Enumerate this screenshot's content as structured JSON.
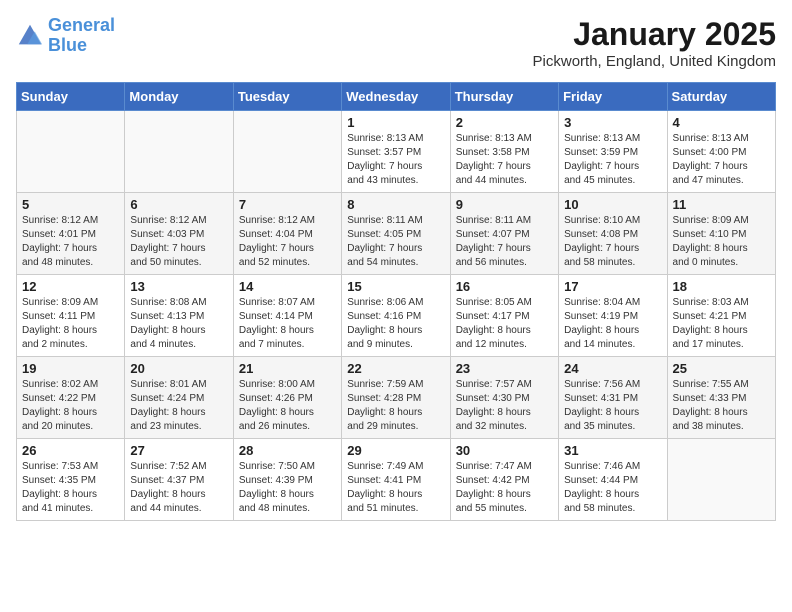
{
  "logo": {
    "line1": "General",
    "line2": "Blue"
  },
  "title": "January 2025",
  "location": "Pickworth, England, United Kingdom",
  "weekdays": [
    "Sunday",
    "Monday",
    "Tuesday",
    "Wednesday",
    "Thursday",
    "Friday",
    "Saturday"
  ],
  "weeks": [
    [
      {
        "day": "",
        "info": ""
      },
      {
        "day": "",
        "info": ""
      },
      {
        "day": "",
        "info": ""
      },
      {
        "day": "1",
        "info": "Sunrise: 8:13 AM\nSunset: 3:57 PM\nDaylight: 7 hours\nand 43 minutes."
      },
      {
        "day": "2",
        "info": "Sunrise: 8:13 AM\nSunset: 3:58 PM\nDaylight: 7 hours\nand 44 minutes."
      },
      {
        "day": "3",
        "info": "Sunrise: 8:13 AM\nSunset: 3:59 PM\nDaylight: 7 hours\nand 45 minutes."
      },
      {
        "day": "4",
        "info": "Sunrise: 8:13 AM\nSunset: 4:00 PM\nDaylight: 7 hours\nand 47 minutes."
      }
    ],
    [
      {
        "day": "5",
        "info": "Sunrise: 8:12 AM\nSunset: 4:01 PM\nDaylight: 7 hours\nand 48 minutes."
      },
      {
        "day": "6",
        "info": "Sunrise: 8:12 AM\nSunset: 4:03 PM\nDaylight: 7 hours\nand 50 minutes."
      },
      {
        "day": "7",
        "info": "Sunrise: 8:12 AM\nSunset: 4:04 PM\nDaylight: 7 hours\nand 52 minutes."
      },
      {
        "day": "8",
        "info": "Sunrise: 8:11 AM\nSunset: 4:05 PM\nDaylight: 7 hours\nand 54 minutes."
      },
      {
        "day": "9",
        "info": "Sunrise: 8:11 AM\nSunset: 4:07 PM\nDaylight: 7 hours\nand 56 minutes."
      },
      {
        "day": "10",
        "info": "Sunrise: 8:10 AM\nSunset: 4:08 PM\nDaylight: 7 hours\nand 58 minutes."
      },
      {
        "day": "11",
        "info": "Sunrise: 8:09 AM\nSunset: 4:10 PM\nDaylight: 8 hours\nand 0 minutes."
      }
    ],
    [
      {
        "day": "12",
        "info": "Sunrise: 8:09 AM\nSunset: 4:11 PM\nDaylight: 8 hours\nand 2 minutes."
      },
      {
        "day": "13",
        "info": "Sunrise: 8:08 AM\nSunset: 4:13 PM\nDaylight: 8 hours\nand 4 minutes."
      },
      {
        "day": "14",
        "info": "Sunrise: 8:07 AM\nSunset: 4:14 PM\nDaylight: 8 hours\nand 7 minutes."
      },
      {
        "day": "15",
        "info": "Sunrise: 8:06 AM\nSunset: 4:16 PM\nDaylight: 8 hours\nand 9 minutes."
      },
      {
        "day": "16",
        "info": "Sunrise: 8:05 AM\nSunset: 4:17 PM\nDaylight: 8 hours\nand 12 minutes."
      },
      {
        "day": "17",
        "info": "Sunrise: 8:04 AM\nSunset: 4:19 PM\nDaylight: 8 hours\nand 14 minutes."
      },
      {
        "day": "18",
        "info": "Sunrise: 8:03 AM\nSunset: 4:21 PM\nDaylight: 8 hours\nand 17 minutes."
      }
    ],
    [
      {
        "day": "19",
        "info": "Sunrise: 8:02 AM\nSunset: 4:22 PM\nDaylight: 8 hours\nand 20 minutes."
      },
      {
        "day": "20",
        "info": "Sunrise: 8:01 AM\nSunset: 4:24 PM\nDaylight: 8 hours\nand 23 minutes."
      },
      {
        "day": "21",
        "info": "Sunrise: 8:00 AM\nSunset: 4:26 PM\nDaylight: 8 hours\nand 26 minutes."
      },
      {
        "day": "22",
        "info": "Sunrise: 7:59 AM\nSunset: 4:28 PM\nDaylight: 8 hours\nand 29 minutes."
      },
      {
        "day": "23",
        "info": "Sunrise: 7:57 AM\nSunset: 4:30 PM\nDaylight: 8 hours\nand 32 minutes."
      },
      {
        "day": "24",
        "info": "Sunrise: 7:56 AM\nSunset: 4:31 PM\nDaylight: 8 hours\nand 35 minutes."
      },
      {
        "day": "25",
        "info": "Sunrise: 7:55 AM\nSunset: 4:33 PM\nDaylight: 8 hours\nand 38 minutes."
      }
    ],
    [
      {
        "day": "26",
        "info": "Sunrise: 7:53 AM\nSunset: 4:35 PM\nDaylight: 8 hours\nand 41 minutes."
      },
      {
        "day": "27",
        "info": "Sunrise: 7:52 AM\nSunset: 4:37 PM\nDaylight: 8 hours\nand 44 minutes."
      },
      {
        "day": "28",
        "info": "Sunrise: 7:50 AM\nSunset: 4:39 PM\nDaylight: 8 hours\nand 48 minutes."
      },
      {
        "day": "29",
        "info": "Sunrise: 7:49 AM\nSunset: 4:41 PM\nDaylight: 8 hours\nand 51 minutes."
      },
      {
        "day": "30",
        "info": "Sunrise: 7:47 AM\nSunset: 4:42 PM\nDaylight: 8 hours\nand 55 minutes."
      },
      {
        "day": "31",
        "info": "Sunrise: 7:46 AM\nSunset: 4:44 PM\nDaylight: 8 hours\nand 58 minutes."
      },
      {
        "day": "",
        "info": ""
      }
    ]
  ]
}
